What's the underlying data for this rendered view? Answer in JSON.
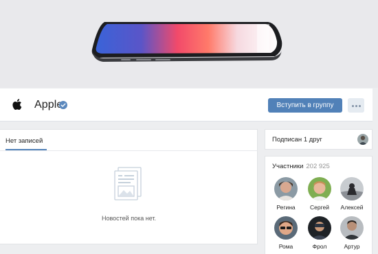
{
  "group": {
    "name": "Apple",
    "join_label": "Вступить в группу",
    "logo_icon": "apple-logo-icon",
    "verified_icon": "verified-check-icon",
    "more_icon": "more-dots-icon"
  },
  "wall": {
    "tab_label": "Нет записей",
    "empty_message": "Новостей пока нет.",
    "empty_icon": "empty-posts-icon"
  },
  "friends": {
    "label": "Подписан 1 друг"
  },
  "members": {
    "title": "Участники",
    "count": "202 925",
    "items": [
      {
        "name": "Регина"
      },
      {
        "name": "Сергей"
      },
      {
        "name": "Алексей"
      },
      {
        "name": "Рома"
      },
      {
        "name": "Фрол"
      },
      {
        "name": "Артур"
      }
    ]
  },
  "colors": {
    "accent": "#5181b8",
    "background": "#edeef0",
    "verified": "#5b88bd"
  }
}
